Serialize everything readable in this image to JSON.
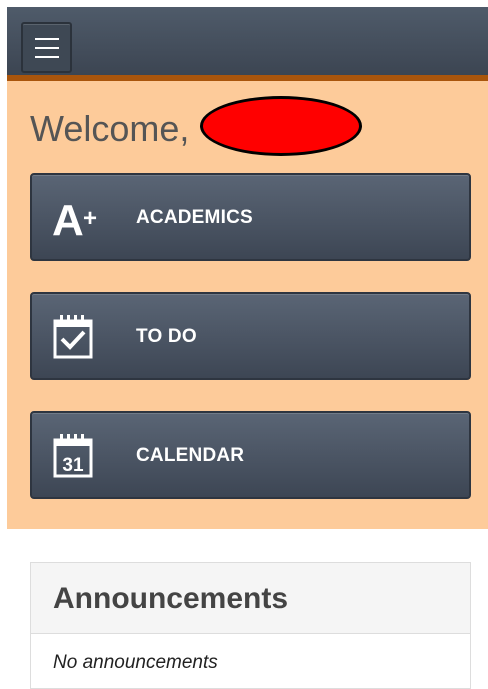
{
  "header": {
    "menu_icon": "hamburger-menu-icon",
    "bar_color": "#45505e",
    "accent_color": "#a9550c"
  },
  "welcome": {
    "greeting": "Welcome,"
  },
  "tiles": [
    {
      "label": "ACADEMICS",
      "icon": "academics-a-plus-icon"
    },
    {
      "label": "TO DO",
      "icon": "todo-checklist-icon"
    },
    {
      "label": "CALENDAR",
      "icon": "calendar-icon",
      "icon_text": "31"
    }
  ],
  "announcements": {
    "title": "Announcements",
    "empty_message": "No announcements"
  },
  "colors": {
    "dashboard_bg": "#fdcb9a",
    "tile_bg": "#4a5462"
  }
}
